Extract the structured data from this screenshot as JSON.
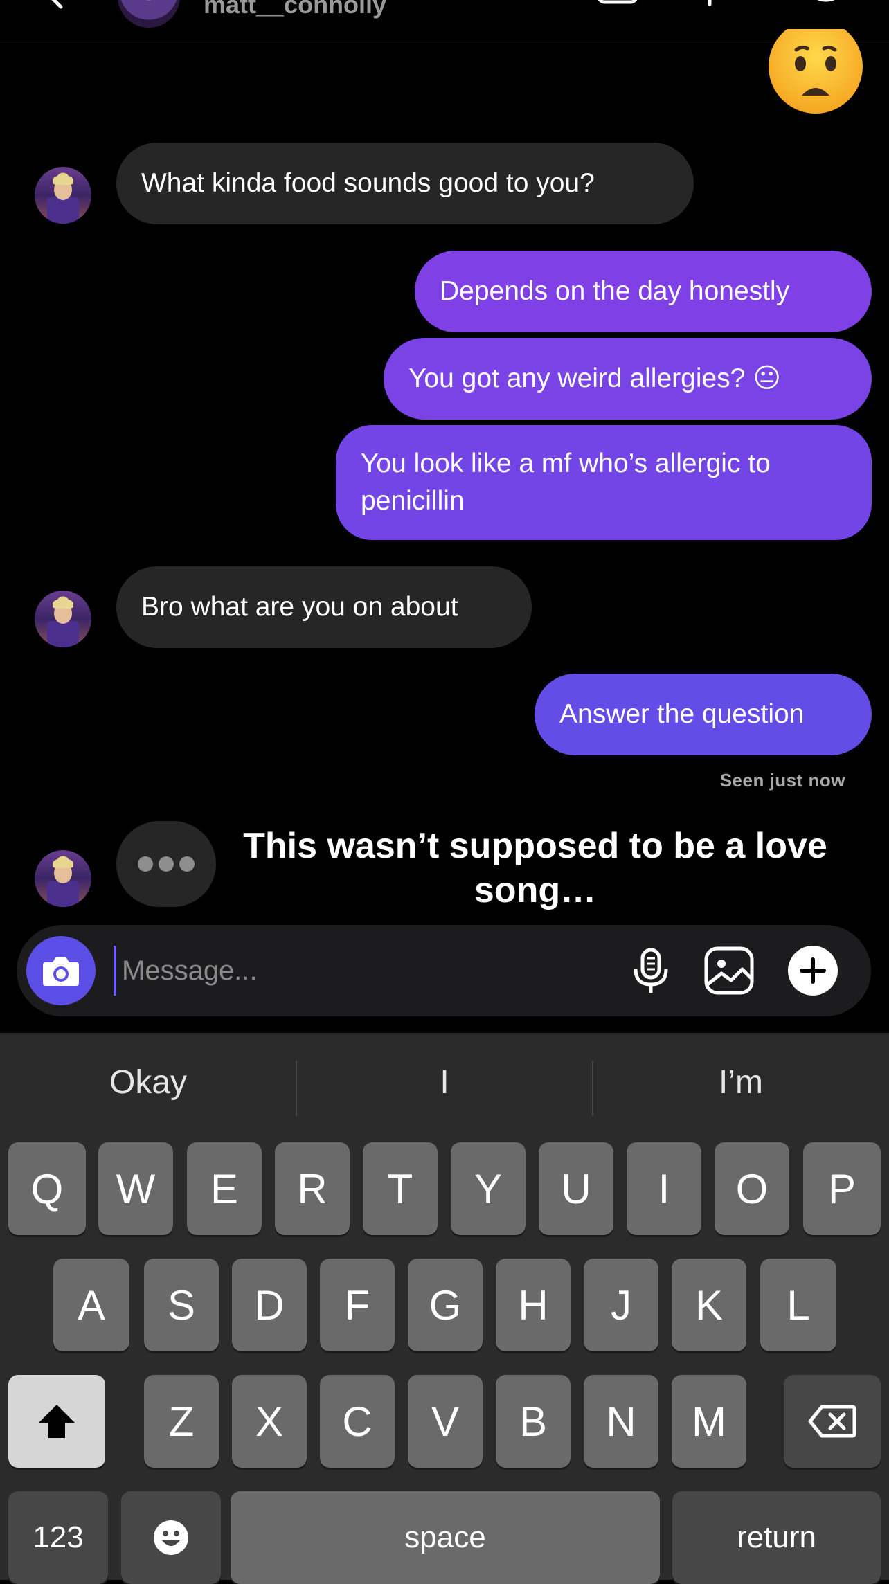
{
  "header": {
    "username": "matt__connolly"
  },
  "messages": [
    {
      "from": "them",
      "text": "What kinda food sounds good to you?"
    },
    {
      "from": "me",
      "text": "Depends on the day honestly"
    },
    {
      "from": "me",
      "text": "You got any weird allergies? 😐"
    },
    {
      "from": "me",
      "text": "You look like a mf who’s allergic to penicillin"
    },
    {
      "from": "them",
      "text": "Bro what are you on about"
    },
    {
      "from": "me",
      "text": "Answer the question"
    }
  ],
  "reaction_emoji": "😦",
  "seen_status": "Seen just now",
  "overlay_caption": "This wasn’t supposed to be a love song…",
  "composer": {
    "placeholder": "Message...",
    "camera_icon": "camera-icon",
    "mic_icon": "microphone-icon",
    "gallery_icon": "gallery-icon",
    "plus_icon": "plus-icon"
  },
  "keyboard": {
    "suggestions": [
      "Okay",
      "I",
      "I’m"
    ],
    "row1": [
      "Q",
      "W",
      "E",
      "R",
      "T",
      "Y",
      "U",
      "I",
      "O",
      "P"
    ],
    "row2": [
      "A",
      "S",
      "D",
      "F",
      "G",
      "H",
      "J",
      "K",
      "L"
    ],
    "row3": [
      "Z",
      "X",
      "C",
      "V",
      "B",
      "N",
      "M"
    ],
    "numbers_label": "123",
    "space_label": "space",
    "return_label": "return"
  },
  "colors": {
    "incoming_bubble": "#262626",
    "outgoing_gradient_top": "#8a3fe6",
    "outgoing_gradient_bottom": "#5f4ee6",
    "camera_button": "#5b4ee6"
  }
}
